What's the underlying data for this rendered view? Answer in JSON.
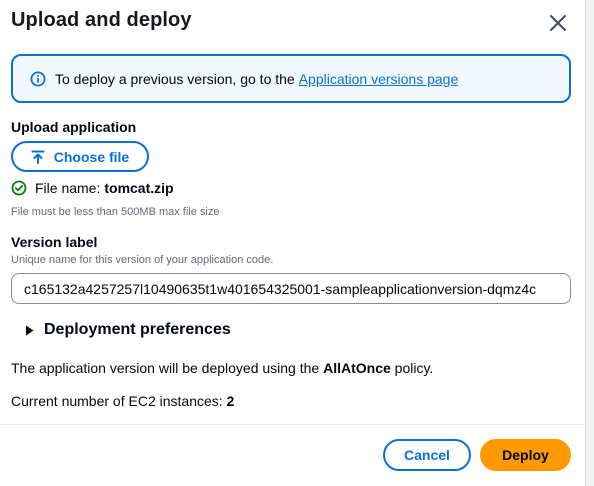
{
  "modal": {
    "title": "Upload and deploy"
  },
  "info": {
    "text": "To deploy a previous version, go to the",
    "link": "Application versions page"
  },
  "upload": {
    "label": "Upload application",
    "button": "Choose file",
    "file_label": "File name:",
    "file_name": "tomcat.zip",
    "hint": "File must be less than 500MB max file size"
  },
  "version": {
    "label": "Version label",
    "description": "Unique name for this version of your application code.",
    "value": "c165132a4257257l10490635t1w401654325001-sampleapplicationversion-dqmz4c"
  },
  "deployment": {
    "expander_label": "Deployment preferences",
    "policy_prefix": "The application version will be deployed using the",
    "policy_name": "AllAtOnce",
    "policy_suffix": "policy.",
    "instances_label": "Current number of EC2 instances:",
    "instances_count": "2"
  },
  "footer": {
    "cancel": "Cancel",
    "deploy": "Deploy"
  },
  "colors": {
    "link_blue": "#0972d3",
    "success_green": "#037f0c",
    "deploy_orange": "#ff9900"
  }
}
